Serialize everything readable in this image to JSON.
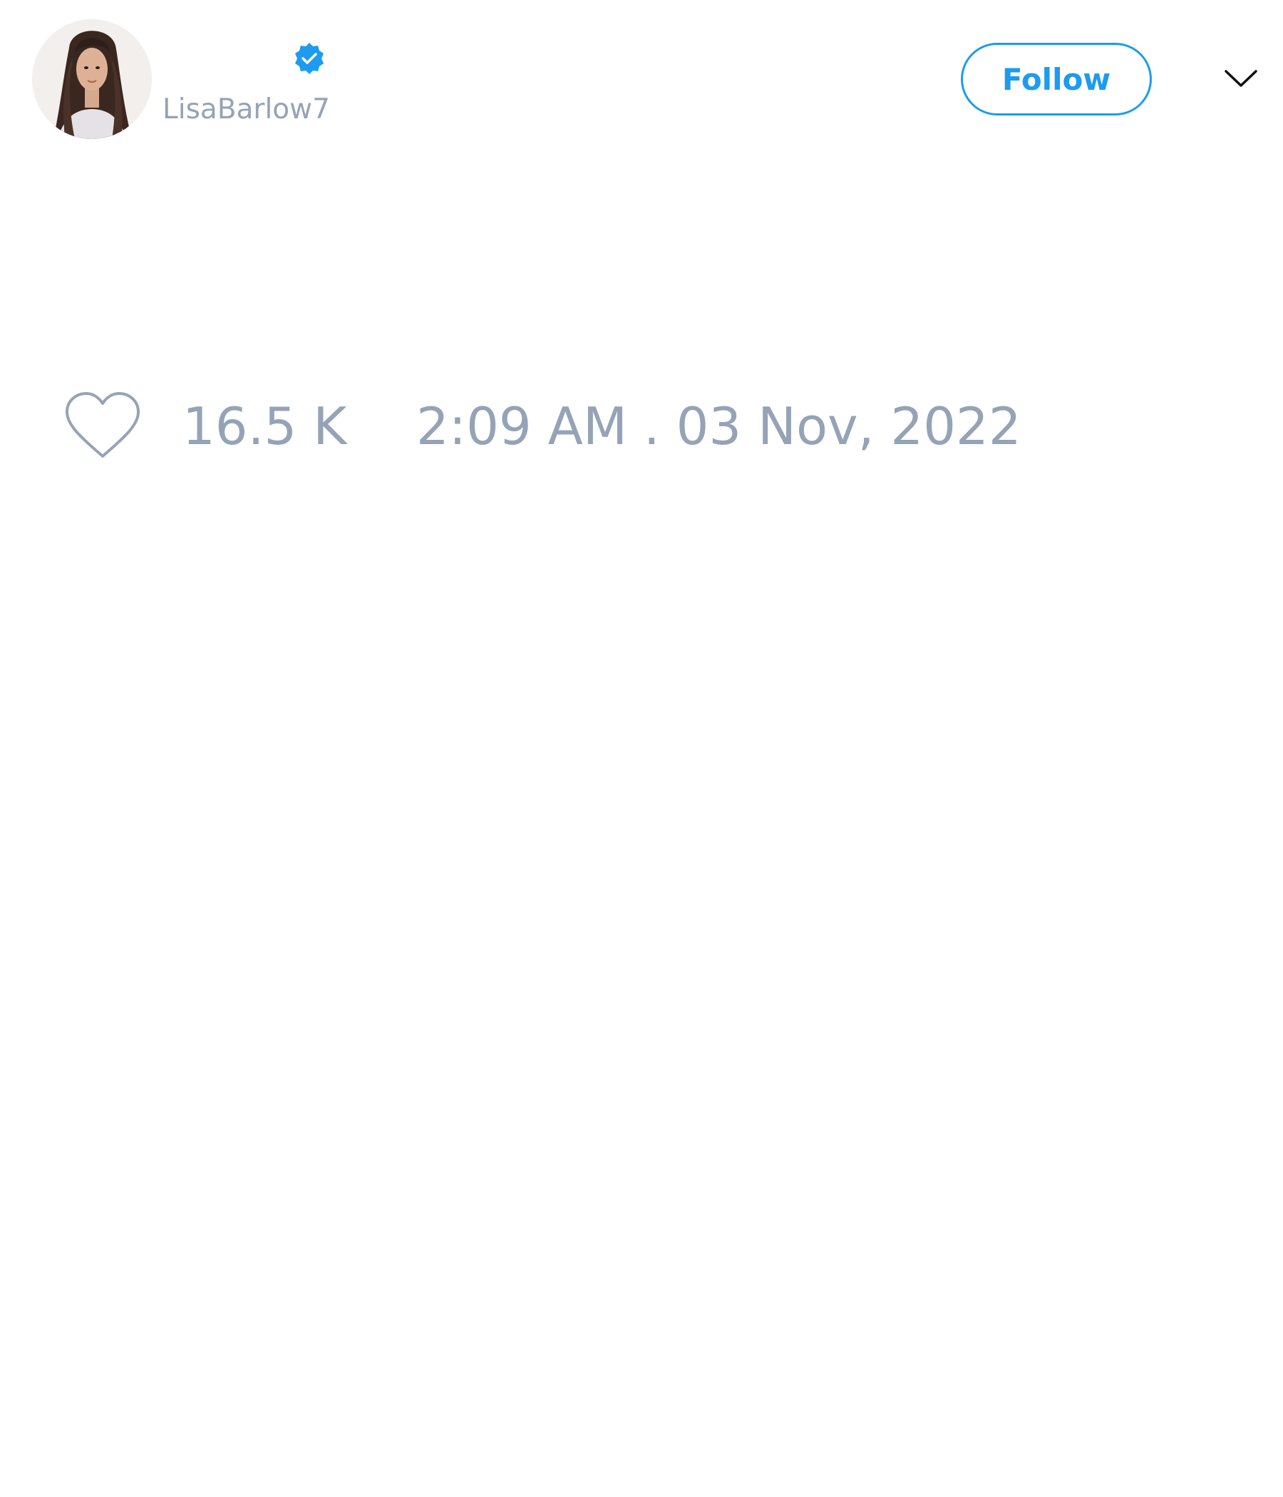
{
  "author": {
    "handle": "LisaBarlow7",
    "verified": true,
    "avatar_icon": "profile-photo"
  },
  "actions": {
    "follow_label": "Follow",
    "menu_icon": "chevron-down-icon"
  },
  "stats": {
    "like_icon": "heart-outline-icon",
    "likes": "16.5 K",
    "timestamp": "2:09 AM . 03 Nov, 2022"
  },
  "colors": {
    "accent": "#1d9bf0",
    "muted_text": "#95a3b6",
    "background": "#ffffff"
  }
}
